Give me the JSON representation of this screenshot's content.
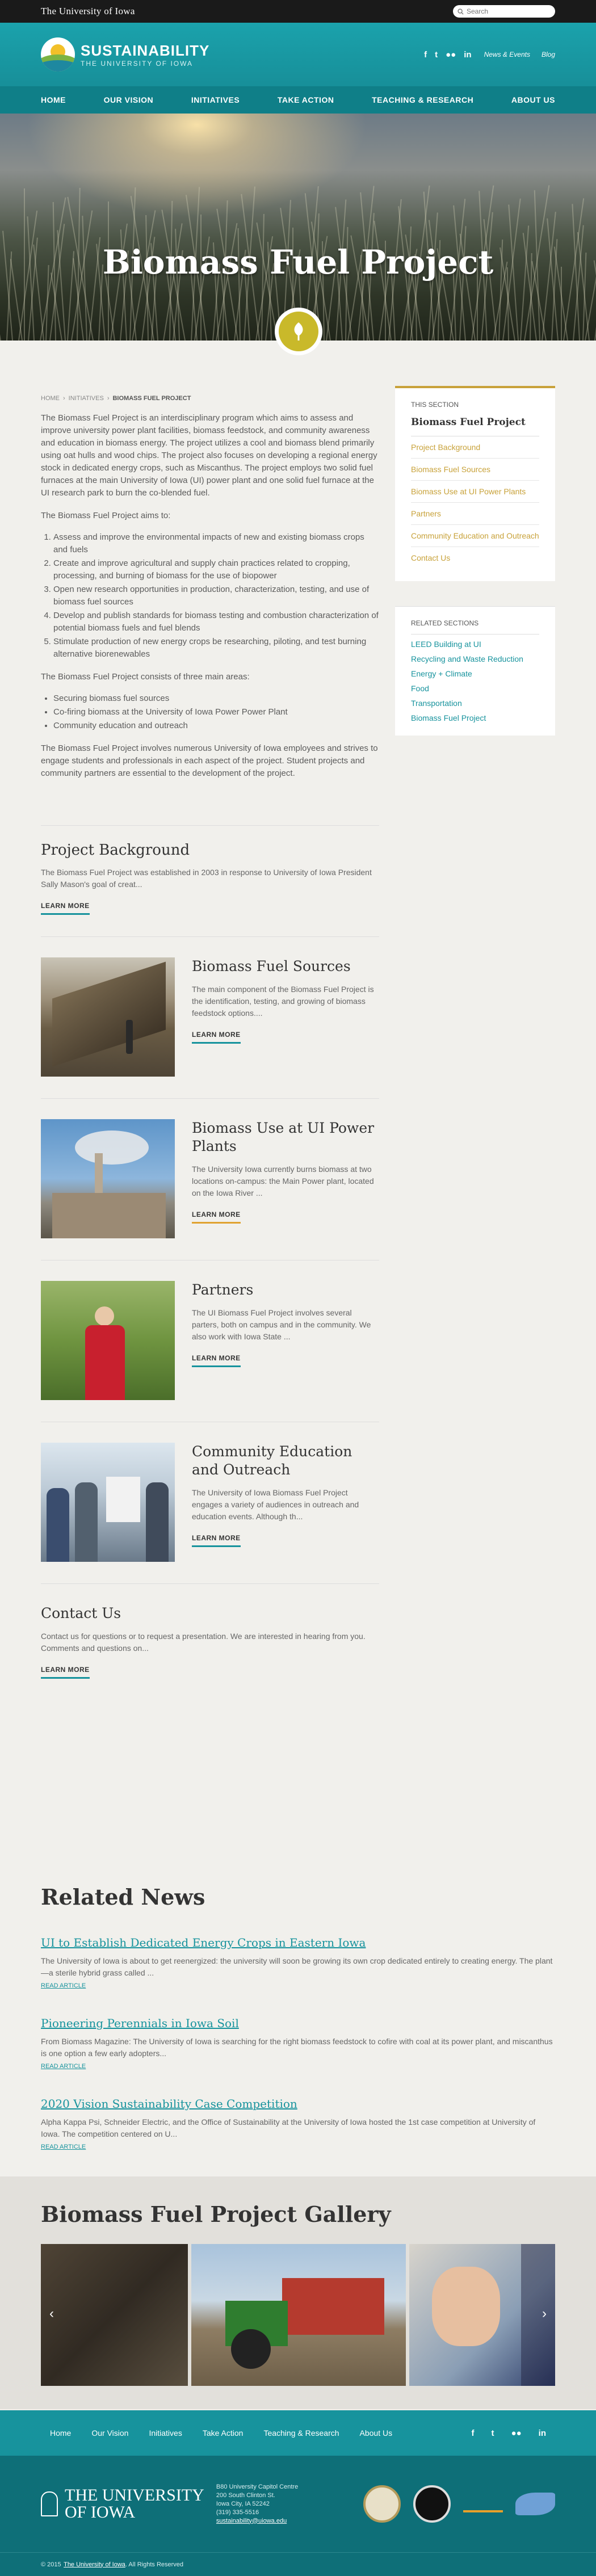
{
  "topbar": {
    "brand": "The University of Iowa",
    "search_placeholder": "Search"
  },
  "header": {
    "logo_title": "SUSTAINABILITY",
    "logo_subtitle": "THE UNIVERSITY OF IOWA",
    "social": [
      "f",
      "t",
      "flickr",
      "in"
    ],
    "links": [
      "News & Events",
      "Blog"
    ]
  },
  "nav": [
    "HOME",
    "OUR VISION",
    "INITIATIVES",
    "TAKE ACTION",
    "TEACHING & RESEARCH",
    "ABOUT US"
  ],
  "hero": {
    "title": "Biomass Fuel Project"
  },
  "breadcrumb": [
    "HOME",
    "INITIATIVES",
    "BIOMASS FUEL PROJECT"
  ],
  "intro": {
    "p1": "The Biomass Fuel Project is an interdisciplinary program which aims to assess and improve university power plant facilities, biomass feedstock, and community awareness and education in biomass energy. The project utilizes a cool and biomass blend primarily using oat hulls and wood chips. The project also focuses on developing a regional energy stock in dedicated energy crops, such as Miscanthus. The project employs two solid fuel furnaces at the main University of Iowa (UI) power plant and one solid fuel furnace at the UI research park to burn the co-blended fuel.",
    "p2": "The Biomass Fuel Project aims to:",
    "aims": [
      "Assess and improve the environmental impacts of new and existing biomass crops and fuels",
      "Create and improve agricultural and supply chain practices related to cropping, processing, and burning of biomass for the use of biopower",
      "Open new research opportunities in production, characterization, testing, and use of biomass fuel sources",
      "Develop and publish standards for biomass testing and combustion characterization of potential biomass fuels and fuel blends",
      "Stimulate production of new energy crops be researching, piloting, and test burning alternative biorenewables"
    ],
    "p3": "The Biomass Fuel Project consists of three main areas:",
    "areas": [
      "Securing biomass fuel sources",
      "Co-firing biomass at the University of Iowa Power  Power Plant",
      "Community education and outreach"
    ],
    "p4": "The Biomass Fuel Project involves numerous University of Iowa employees and strives to engage students and professionals in each aspect of the project. Student projects and community partners are essential to the development of the project."
  },
  "background": {
    "title": "Project Background",
    "text": "The Biomass Fuel Project was established in 2003 in response to University of Iowa President Sally Mason's goal of creat...",
    "learn": "LEARN MORE"
  },
  "cards": [
    {
      "title": "Biomass Fuel Sources",
      "text": "The main component of the Biomass Fuel Project is the identification, testing, and growing of biomass feedstock options....",
      "learn": "LEARN MORE"
    },
    {
      "title": "Biomass Use at UI Power Plants",
      "text": "The University Iowa currently burns biomass at two locations on-campus: the Main Power plant, located on the Iowa River ...",
      "learn": "LEARN MORE"
    },
    {
      "title": "Partners",
      "text": "The UI Biomass Fuel Project involves several parters, both on campus and in the community. We also work with Iowa State ...",
      "learn": "LEARN MORE"
    },
    {
      "title": "Community Education and Outreach",
      "text": "The University of Iowa Biomass Fuel Project engages a variety of audiences in outreach and education events. Although th...",
      "learn": "LEARN MORE"
    }
  ],
  "contact": {
    "title": "Contact Us",
    "text": "Contact us for questions or to request a presentation. We are interested in hearing from you.  Comments and questions on...",
    "learn": "LEARN MORE"
  },
  "sidebar": {
    "heading": "THIS SECTION",
    "title": "Biomass Fuel Project",
    "links": [
      "Project Background",
      "Biomass Fuel Sources",
      "Biomass Use at UI Power Plants",
      "Partners",
      "Community Education and Outreach",
      "Contact Us"
    ],
    "related_heading": "RELATED SECTIONS",
    "related": [
      "LEED Building at UI",
      "Recycling and Waste Reduction",
      "Energy + Climate",
      "Food",
      "Transportation",
      "Biomass Fuel Project"
    ]
  },
  "news": {
    "heading": "Related News",
    "items": [
      {
        "title": "UI to Establish Dedicated Energy Crops in Eastern Iowa",
        "text": "The University of Iowa is about to get reenergized: the university will soon be growing its own crop dedicated entirely to creating energy. The plant—a sterile hybrid grass called ...",
        "read": "READ ARTICLE"
      },
      {
        "title": "Pioneering Perennials in Iowa Soil",
        "text": "From Biomass Magazine: The University of Iowa is searching for the right biomass feedstock to cofire with coal at its power plant, and miscanthus is one option a few early adopters...",
        "read": "READ ARTICLE"
      },
      {
        "title": "2020 Vision Sustainability Case Competition",
        "text": "Alpha Kappa Psi, Schneider Electric, and the Office of Sustainability at the University of Iowa hosted the 1st case competition at University of Iowa. The competition centered on U...",
        "read": "READ ARTICLE"
      }
    ]
  },
  "gallery": {
    "title": "Biomass Fuel Project Gallery"
  },
  "footer": {
    "links": [
      "Home",
      "Our Vision",
      "Initiatives",
      "Take Action",
      "Teaching & Research",
      "About Us"
    ],
    "social": [
      "f",
      "t",
      "flickr",
      "in"
    ],
    "brand_line1": "THE UNIVERSITY",
    "brand_line2": "OF IOWA",
    "address": [
      "B80 University Capitol Centre",
      "200 South Clinton St.",
      "Iowa City, IA 52242",
      "(319) 335-5516"
    ],
    "email": "sustainability@uiowa.edu",
    "seals": [
      "stars",
      "seal",
      "arrows",
      "leaf"
    ],
    "copyright": "© 2015",
    "copyright_link": "The University of Iowa",
    "copyright_tail": ". All Rights Reserved"
  }
}
